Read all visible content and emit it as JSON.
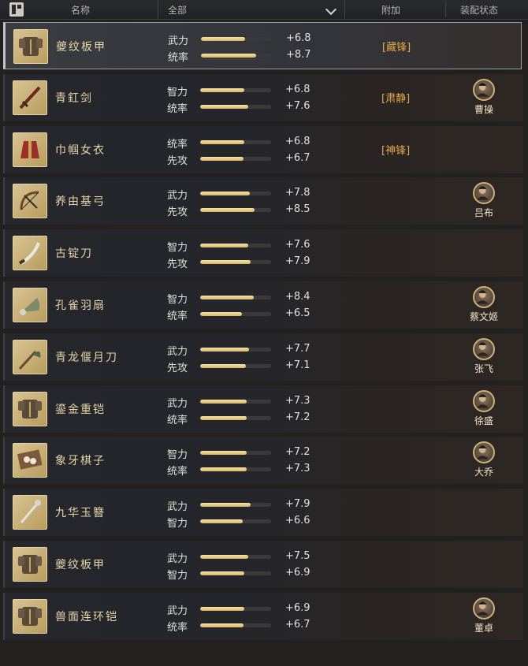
{
  "header": {
    "name_label": "名称",
    "filter_value": "全部",
    "bonus_label": "附加",
    "equip_label": "装配状态"
  },
  "items": [
    {
      "name": "夔纹板甲",
      "icon": "armor-icon",
      "selected": true,
      "stats": [
        {
          "label": "武力",
          "value": "+6.8",
          "level": 0.62
        },
        {
          "label": "统率",
          "value": "+8.7",
          "level": 0.78
        }
      ],
      "bonus": "[藏锋]",
      "general": ""
    },
    {
      "name": "青釭剑",
      "icon": "sword-icon",
      "selected": false,
      "stats": [
        {
          "label": "智力",
          "value": "+6.8",
          "level": 0.62
        },
        {
          "label": "统率",
          "value": "+7.6",
          "level": 0.68
        }
      ],
      "bonus": "[肃静]",
      "general": "曹操"
    },
    {
      "name": "巾帼女衣",
      "icon": "robe-icon",
      "selected": false,
      "stats": [
        {
          "label": "统率",
          "value": "+6.8",
          "level": 0.62
        },
        {
          "label": "先攻",
          "value": "+6.7",
          "level": 0.61
        }
      ],
      "bonus": "[神锋]",
      "general": ""
    },
    {
      "name": "养由基弓",
      "icon": "bow-icon",
      "selected": false,
      "stats": [
        {
          "label": "武力",
          "value": "+7.8",
          "level": 0.7
        },
        {
          "label": "先攻",
          "value": "+8.5",
          "level": 0.77
        }
      ],
      "bonus": "",
      "general": "吕布"
    },
    {
      "name": "古锭刀",
      "icon": "saber-icon",
      "selected": false,
      "stats": [
        {
          "label": "智力",
          "value": "+7.6",
          "level": 0.68
        },
        {
          "label": "先攻",
          "value": "+7.9",
          "level": 0.71
        }
      ],
      "bonus": "",
      "general": ""
    },
    {
      "name": "孔雀羽扇",
      "icon": "fan-icon",
      "selected": false,
      "stats": [
        {
          "label": "智力",
          "value": "+8.4",
          "level": 0.76
        },
        {
          "label": "统率",
          "value": "+6.5",
          "level": 0.59
        }
      ],
      "bonus": "",
      "general": "蔡文姬"
    },
    {
      "name": "青龙偃月刀",
      "icon": "glaive-icon",
      "selected": false,
      "stats": [
        {
          "label": "武力",
          "value": "+7.7",
          "level": 0.69
        },
        {
          "label": "先攻",
          "value": "+7.1",
          "level": 0.64
        }
      ],
      "bonus": "",
      "general": "张飞"
    },
    {
      "name": "鎏金重铠",
      "icon": "armor-icon",
      "selected": false,
      "stats": [
        {
          "label": "武力",
          "value": "+7.3",
          "level": 0.66
        },
        {
          "label": "统率",
          "value": "+7.2",
          "level": 0.65
        }
      ],
      "bonus": "",
      "general": "徐盛"
    },
    {
      "name": "象牙棋子",
      "icon": "chess-icon",
      "selected": false,
      "stats": [
        {
          "label": "智力",
          "value": "+7.2",
          "level": 0.65
        },
        {
          "label": "统率",
          "value": "+7.3",
          "level": 0.66
        }
      ],
      "bonus": "",
      "general": "大乔"
    },
    {
      "name": "九华玉簪",
      "icon": "hairpin-icon",
      "selected": false,
      "stats": [
        {
          "label": "武力",
          "value": "+7.9",
          "level": 0.71
        },
        {
          "label": "智力",
          "value": "+6.6",
          "level": 0.6
        }
      ],
      "bonus": "",
      "general": ""
    },
    {
      "name": "夔纹板甲",
      "icon": "armor-icon",
      "selected": false,
      "stats": [
        {
          "label": "武力",
          "value": "+7.5",
          "level": 0.68
        },
        {
          "label": "智力",
          "value": "+6.9",
          "level": 0.62
        }
      ],
      "bonus": "",
      "general": ""
    },
    {
      "name": "兽面连环铠",
      "icon": "armor-icon",
      "selected": false,
      "stats": [
        {
          "label": "武力",
          "value": "+6.9",
          "level": 0.62
        },
        {
          "label": "统率",
          "value": "+6.7",
          "level": 0.61
        }
      ],
      "bonus": "",
      "general": "董卓"
    }
  ],
  "colors": {
    "gold": "#e6d6a8",
    "bonus": "#e3a84a",
    "bar_fill": "#f5e3a6"
  }
}
